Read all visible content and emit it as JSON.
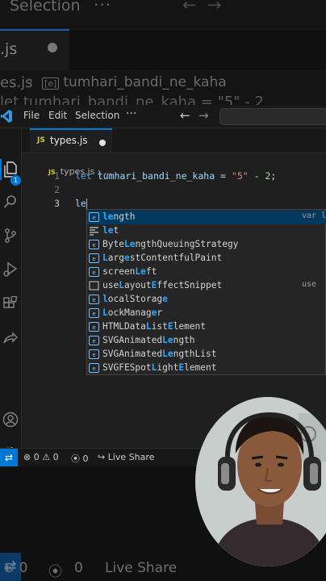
{
  "background": {
    "title": "Selection",
    "tab_label": ".js",
    "breadcrumb_file": "es.js",
    "breadcrumb_symbol": "tumhari_bandi_ne_kaha",
    "code_fragment": "let tumhari_bandi_ne_kaha = \"5\" - 2",
    "status_problems": "⊗ 0",
    "status_ports": "0",
    "status_liveshare": "Live Share"
  },
  "menu": {
    "file": "File",
    "edit": "Edit",
    "selection": "Selection",
    "more": "···"
  },
  "nav": {
    "back": "←",
    "forward": "→"
  },
  "activity": {
    "explorer_badge": "1"
  },
  "tab": {
    "lang": "JS",
    "label": "types.js"
  },
  "breadcrumb": {
    "lang": "JS",
    "file": "types.js",
    "sep": " › ",
    "rest": "..."
  },
  "editor": {
    "line_numbers": [
      "1",
      "2",
      "3"
    ],
    "line1": {
      "kw": "let",
      "var": "tumhari_bandi_ne_kaha",
      "op1": " = ",
      "str": "\"5\"",
      "op2": " - ",
      "num": "2",
      "end": ";"
    },
    "line3": "le"
  },
  "suggestions": [
    {
      "pre": "",
      "m1": "le",
      "mid": "ngth",
      "m2": "",
      "post": "",
      "kind": "variable",
      "detail": "var le"
    },
    {
      "pre": "",
      "m1": "le",
      "mid": "t",
      "m2": "",
      "post": "",
      "kind": "keyword",
      "detail": ""
    },
    {
      "pre": "Byte",
      "m1": "Le",
      "mid": "ngthQueuingStrategy",
      "m2": "",
      "post": "",
      "kind": "variable",
      "detail": ""
    },
    {
      "pre": "",
      "m1": "L",
      "mid": "arg",
      "m2": "e",
      "post": "stContentfulPaint",
      "kind": "variable",
      "detail": ""
    },
    {
      "pre": "screen",
      "m1": "Le",
      "mid": "ft",
      "m2": "",
      "post": "",
      "kind": "variable",
      "detail": ""
    },
    {
      "pre": "use",
      "m1": "L",
      "mid": "ayout",
      "m2": "E",
      "post": "ffectSnippet",
      "kind": "snippet",
      "detail": "use"
    },
    {
      "pre": "",
      "m1": "l",
      "mid": "ocalStorag",
      "m2": "e",
      "post": "",
      "kind": "variable",
      "detail": ""
    },
    {
      "pre": "",
      "m1": "L",
      "mid": "ockManag",
      "m2": "e",
      "post": "r",
      "kind": "variable",
      "detail": ""
    },
    {
      "pre": "HTMLData",
      "m1": "L",
      "mid": "ist",
      "m2": "E",
      "post": "lement",
      "kind": "variable",
      "detail": ""
    },
    {
      "pre": "SVGAnimated",
      "m1": "Le",
      "mid": "ngth",
      "m2": "",
      "post": "",
      "kind": "variable",
      "detail": ""
    },
    {
      "pre": "SVGAnimated",
      "m1": "Le",
      "mid": "ngthList",
      "m2": "",
      "post": "",
      "kind": "variable",
      "detail": ""
    },
    {
      "pre": "SVGFESpot",
      "m1": "L",
      "mid": "ight",
      "m2": "E",
      "post": "lement",
      "kind": "variable",
      "detail": ""
    }
  ],
  "status": {
    "problems": "⊗ 0 ⚠ 0",
    "ports": "0",
    "liveshare": "Live Share"
  },
  "colors": {
    "accent": "#0078d4",
    "match": "#2aaaff",
    "selected_row": "#04395e"
  }
}
